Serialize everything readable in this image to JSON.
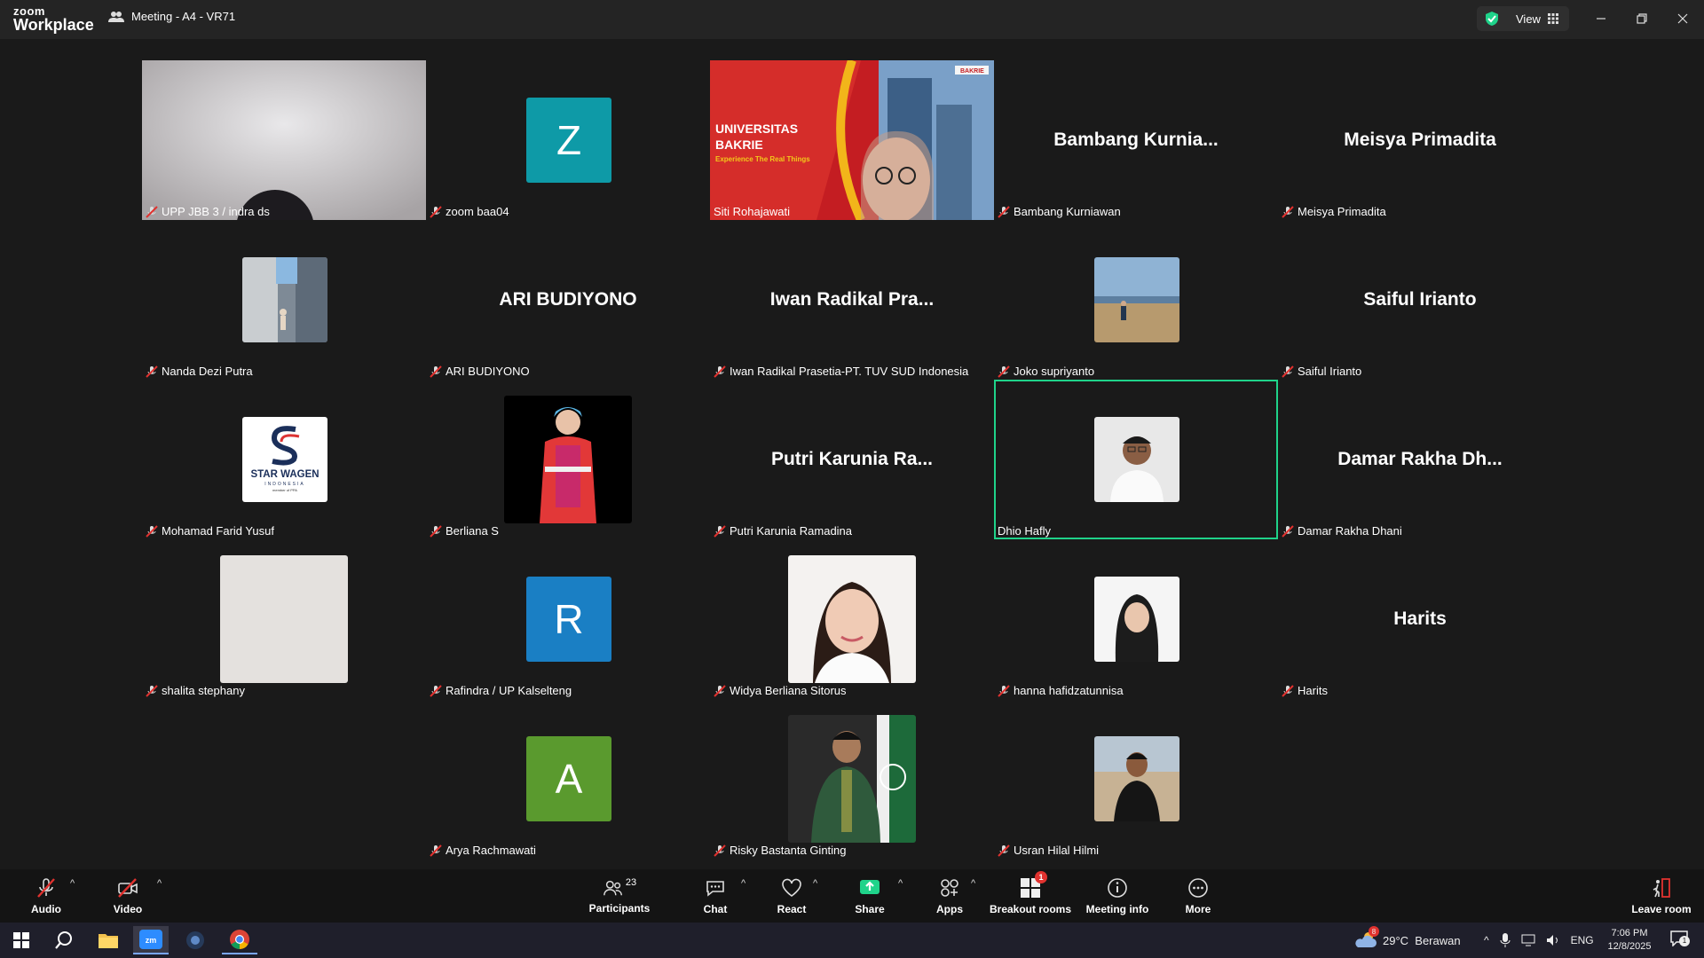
{
  "app": {
    "logo_line1": "zoom",
    "logo_line2": "Workplace",
    "meeting_title": "Meeting - A4 - VR71",
    "view_label": "View"
  },
  "tiles": [
    {
      "name": "UPP JBB 3 / indra ds"
    },
    {
      "name": "zoom baa04",
      "initial": "Z"
    },
    {
      "name": "Siti Rohajawati",
      "slide_title_1": "UNIVERSITAS",
      "slide_title_2": "BAKRIE",
      "slide_tagline": "Experience The Real Things",
      "slide_logo": "BAKRIE"
    },
    {
      "name": "Bambang Kurniawan",
      "display": "Bambang  Kurnia..."
    },
    {
      "name": "Meisya Primadita",
      "display": "Meisya Primadita"
    },
    {
      "name": "Nanda Dezi Putra"
    },
    {
      "name": "ARI BUDIYONO",
      "display": "ARI BUDIYONO"
    },
    {
      "name": "Iwan Radikal Prasetia-PT. TUV SUD Indonesia",
      "display": "Iwan Radikal Pra..."
    },
    {
      "name": "Joko supriyanto"
    },
    {
      "name": "Saiful Irianto",
      "display": "Saiful Irianto"
    },
    {
      "name": "Mohamad Farid Yusuf",
      "logo_text": "STAR WAGEN",
      "logo_sub": "INDONESIA",
      "logo_member": "member of PPA"
    },
    {
      "name": "Berliana S"
    },
    {
      "name": "Putri Karunia Ramadina",
      "display": "Putri  Karunia  Ra..."
    },
    {
      "name": "Dhio Hafly"
    },
    {
      "name": "Damar Rakha Dhani",
      "display": "Damar  Rakha  Dh..."
    },
    {
      "name": "shalita stephany"
    },
    {
      "name": "Rafindra / UP Kalselteng",
      "initial": "R"
    },
    {
      "name": "Widya Berliana Sitorus"
    },
    {
      "name": "hanna hafidzatunnisa"
    },
    {
      "name": "Harits",
      "display": "Harits"
    },
    {
      "name": "Arya Rachmawati",
      "initial": "A"
    },
    {
      "name": "Risky Bastanta Ginting"
    },
    {
      "name": "Usran Hilal Hilmi"
    }
  ],
  "toolbar": {
    "audio": "Audio",
    "video": "Video",
    "participants": "Participants",
    "participants_count": "23",
    "chat": "Chat",
    "react": "React",
    "share": "Share",
    "apps": "Apps",
    "breakout": "Breakout rooms",
    "breakout_badge": "1",
    "meeting_info": "Meeting info",
    "more": "More",
    "leave": "Leave room"
  },
  "taskbar": {
    "weather": "29°C  Berawan",
    "lang": "ENG",
    "time": "7:06 PM",
    "date": "12/8/2025",
    "weather_badge": "8",
    "notif_badge": "1"
  },
  "colors": {
    "active_speaker": "#1fd38a",
    "avatar_z": "#0e9aa7",
    "avatar_r": "#1a7fc4",
    "avatar_a": "#5a9a2e",
    "share_green": "#1fd38a"
  }
}
